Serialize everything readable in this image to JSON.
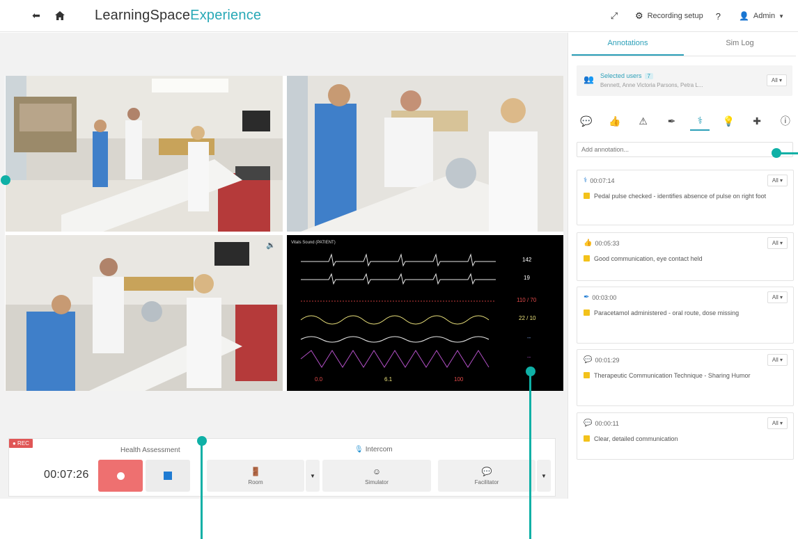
{
  "header": {
    "brand_main": "LearningSpace",
    "brand_accent": "Experience",
    "recording_setup_label": "Recording setup",
    "help_label": "?",
    "user_label": "Admin"
  },
  "controls": {
    "rec_badge": "● REC",
    "title": "Health Assessment",
    "intercom_label": "Intercom",
    "timer": "00:07:26",
    "buttons": [
      {
        "label": "Room"
      },
      {
        "label": "Simulator"
      },
      {
        "label": "Facilitator"
      }
    ]
  },
  "monitor": {
    "title": "Vitals Sound (PATIENT)",
    "values": [
      "142",
      "19",
      "110 / 70",
      "22 / 10",
      "--",
      "--"
    ],
    "bottom": [
      "0.0",
      "6.1",
      "100"
    ]
  },
  "side": {
    "tabs": [
      {
        "label": "Annotations",
        "active": true
      },
      {
        "label": "Sim Log",
        "active": false
      }
    ],
    "selected_users_label": "Selected users",
    "selected_users_count": "7",
    "selected_users_names": "Bennett, Anne Victoria Parsons, Petra L...",
    "all_label": "All",
    "annotation_placeholder": "Add annotation...",
    "tool_icons": [
      "comment-icon",
      "thumbs-up-icon",
      "warning-icon",
      "syringe-icon",
      "stethoscope-icon",
      "lightbulb-icon",
      "first-aid-kit-icon",
      "info-icon"
    ],
    "annotations": [
      {
        "icon": "stethoscope-icon",
        "glyph": "✚",
        "time": "00:07:14",
        "text": "Pedal pulse checked - identifies absence of pulse on right foot"
      },
      {
        "icon": "thumbs-up-icon",
        "glyph": "👍",
        "time": "00:05:33",
        "text": "Good communication, eye contact held"
      },
      {
        "icon": "syringe-icon",
        "glyph": "✎",
        "time": "00:03:00",
        "text": "Paracetamol administered - oral route, dose missing"
      },
      {
        "icon": "comment-icon",
        "glyph": "💬",
        "time": "00:01:29",
        "text": "Therapeutic Communication Technique - Sharing Humor"
      },
      {
        "icon": "comment-icon",
        "glyph": "💬",
        "time": "00:00:11",
        "text": "Clear, detailed communication"
      }
    ]
  },
  "colors": {
    "accent": "#27a8b6",
    "record": "#ee7070",
    "stop": "#1f7bd2",
    "callout": "#0fb0a6",
    "note": "#f3c21b"
  }
}
